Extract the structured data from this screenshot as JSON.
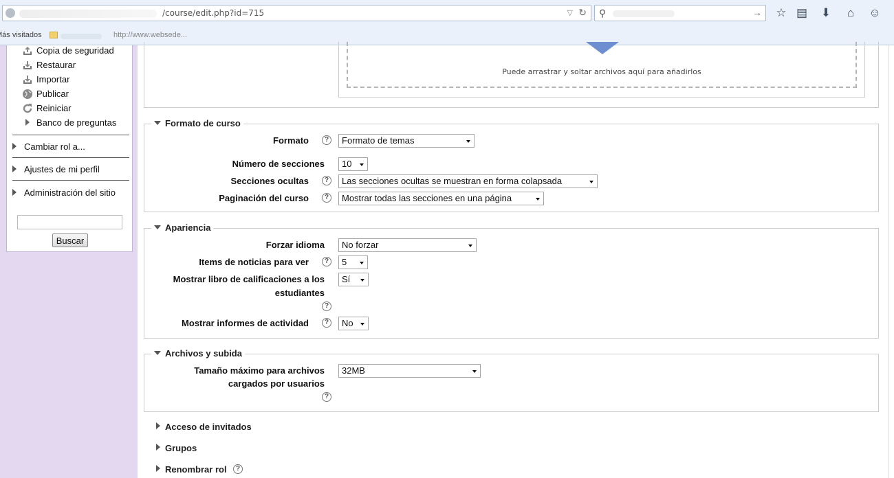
{
  "browser": {
    "url": "/course/edit.php?id=715",
    "bookmarks_label": "Más visitados",
    "bookmark_link": "http://www.websede..."
  },
  "sidebar": {
    "items": [
      {
        "label": "Copia de seguridad",
        "icon": "backup-icon"
      },
      {
        "label": "Restaurar",
        "icon": "restore-icon"
      },
      {
        "label": "Importar",
        "icon": "import-icon"
      },
      {
        "label": "Publicar",
        "icon": "publish-icon"
      },
      {
        "label": "Reiniciar",
        "icon": "reset-icon"
      },
      {
        "label": "Banco de preguntas",
        "icon": "expand-icon"
      }
    ],
    "nodes": [
      {
        "label": "Cambiar rol a..."
      },
      {
        "label": "Ajustes de mi perfil"
      },
      {
        "label": "Administración del sitio"
      }
    ],
    "search_button": "Buscar"
  },
  "upload": {
    "drop_text": "Puede arrastrar y soltar archivos aquí para añadirlos"
  },
  "formato_curso": {
    "legend": "Formato de curso",
    "formato": {
      "label": "Formato",
      "value": "Formato de temas"
    },
    "num_secciones": {
      "label": "Número de secciones",
      "value": "10"
    },
    "secciones_ocultas": {
      "label": "Secciones ocultas",
      "value": "Las secciones ocultas se muestran en forma colapsada"
    },
    "paginacion": {
      "label": "Paginación del curso",
      "value": "Mostrar todas las secciones en una página"
    }
  },
  "apariencia": {
    "legend": "Apariencia",
    "forzar_idioma": {
      "label": "Forzar idioma",
      "value": "No forzar"
    },
    "items_noticias": {
      "label": "Items de noticias para ver",
      "value": "5"
    },
    "libro_calificaciones": {
      "label_line1": "Mostrar libro de calificaciones a los",
      "label_line2": "estudiantes",
      "value": "Sí"
    },
    "informes_actividad": {
      "label": "Mostrar informes de actividad",
      "value": "No"
    }
  },
  "archivos": {
    "legend": "Archivos y subida",
    "tamano_maximo": {
      "label_line1": "Tamaño máximo para archivos",
      "label_line2": "cargados por usuarios",
      "value": "32MB"
    }
  },
  "collapsed_sections": {
    "acceso_invitados": "Acceso de invitados",
    "grupos": "Grupos",
    "renombrar_rol": "Renombrar rol"
  },
  "help_glyph": "?"
}
